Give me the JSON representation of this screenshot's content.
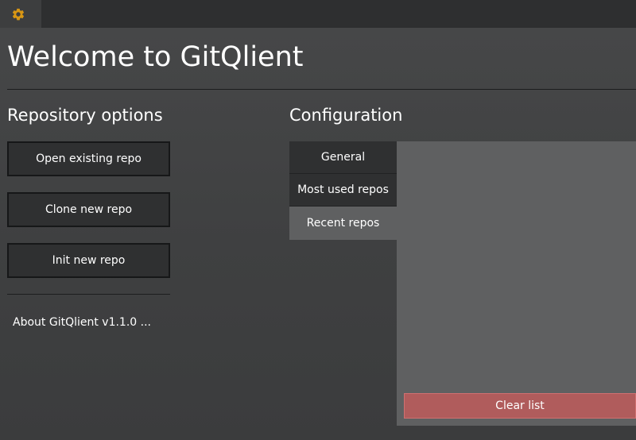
{
  "topbar": {
    "settings_icon": "gear-icon",
    "accent_color": "#d89614"
  },
  "welcome": {
    "title": "Welcome to GitQlient"
  },
  "repository_options": {
    "title": "Repository options",
    "buttons": [
      {
        "label": "Open existing repo"
      },
      {
        "label": "Clone new repo"
      },
      {
        "label": "Init new repo"
      }
    ],
    "about": "About GitQlient v1.1.0 ..."
  },
  "configuration": {
    "title": "Configuration",
    "tabs": [
      {
        "label": "General"
      },
      {
        "label": "Most used repos"
      },
      {
        "label": "Recent repos",
        "active": true
      }
    ],
    "clear_button": "Clear list",
    "clear_button_color": "#b05c5c"
  }
}
